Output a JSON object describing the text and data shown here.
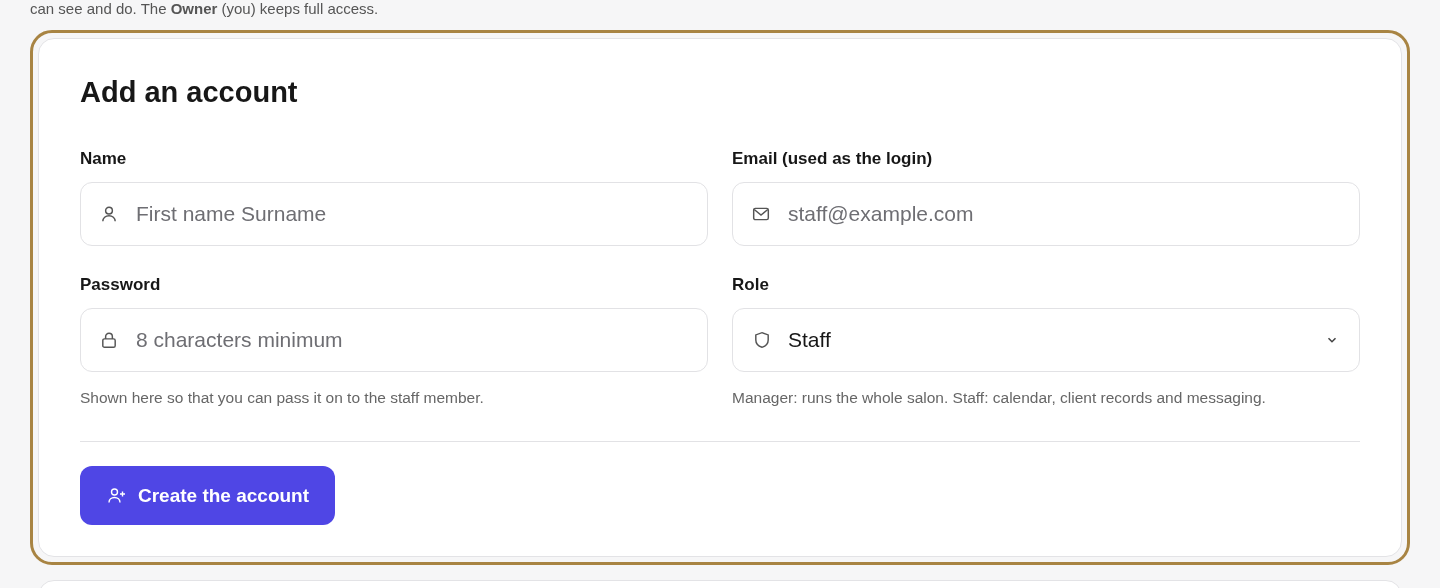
{
  "intro": "can see and do. The **Owner** (you) keeps full access.",
  "form": {
    "title": "Add an account",
    "name_field": {
      "label": "Name",
      "placeholder": "First name Surname"
    },
    "email_field": {
      "label": "Email (used as the login)",
      "placeholder": "staff@example.com"
    },
    "password_field": {
      "label": "Password",
      "placeholder": "8 characters minimum",
      "hint": "Shown here so that you can pass it on to the staff member."
    },
    "role_field": {
      "label": "Role",
      "value": "Staff",
      "hint": "Manager: runs the whole salon. Staff: calendar, client records and messaging."
    },
    "submit": "Create the account"
  }
}
